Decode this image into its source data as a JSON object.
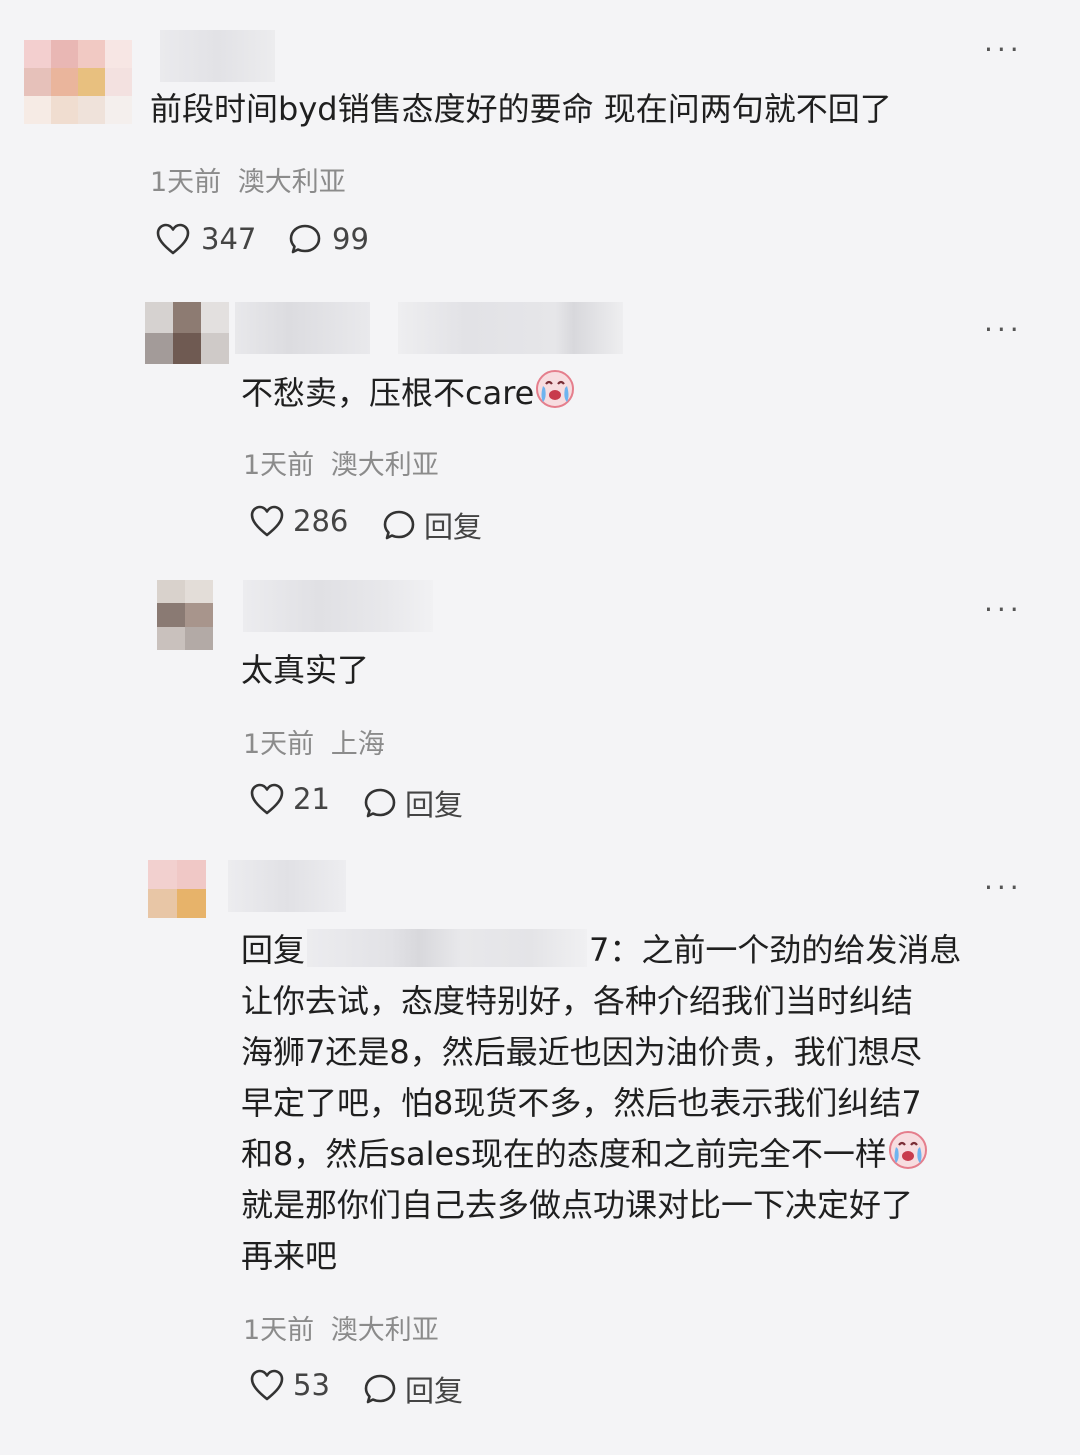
{
  "comments": [
    {
      "text": "前段时间byd销售态度好的要命 现在问两句就不回了",
      "time": "1天前",
      "location": "澳大利亚",
      "likes": "347",
      "replies": "99"
    },
    {
      "text": "不愁卖，压根不care",
      "time": "1天前",
      "location": "澳大利亚",
      "likes": "286",
      "reply_label": "回复"
    },
    {
      "text": "太真实了",
      "time": "1天前",
      "location": "上海",
      "likes": "21",
      "reply_label": "回复"
    },
    {
      "reply_prefix": "回复",
      "reply_tail": "7：之前一个劲的给发消息",
      "lines": [
        "让你去试，态度特别好，各种介绍我们当时纠结",
        "海狮7还是8，然后最近也因为油价贵，我们想尽",
        "早定了吧，怕8现货不多，然后也表示我们纠结7",
        "和8，然后sales现在的态度和之前完全不一样",
        "就是那你们自己去多做点功课对比一下决定好了",
        "再来吧"
      ],
      "time": "1天前",
      "location": "澳大利亚",
      "likes": "53",
      "reply_label": "回复"
    }
  ],
  "more_label": "···",
  "icons": {
    "like": "heart-outline-icon",
    "comment": "speech-bubble-icon",
    "more": "more-dots-icon",
    "emoji": "crying-emoji-icon"
  }
}
